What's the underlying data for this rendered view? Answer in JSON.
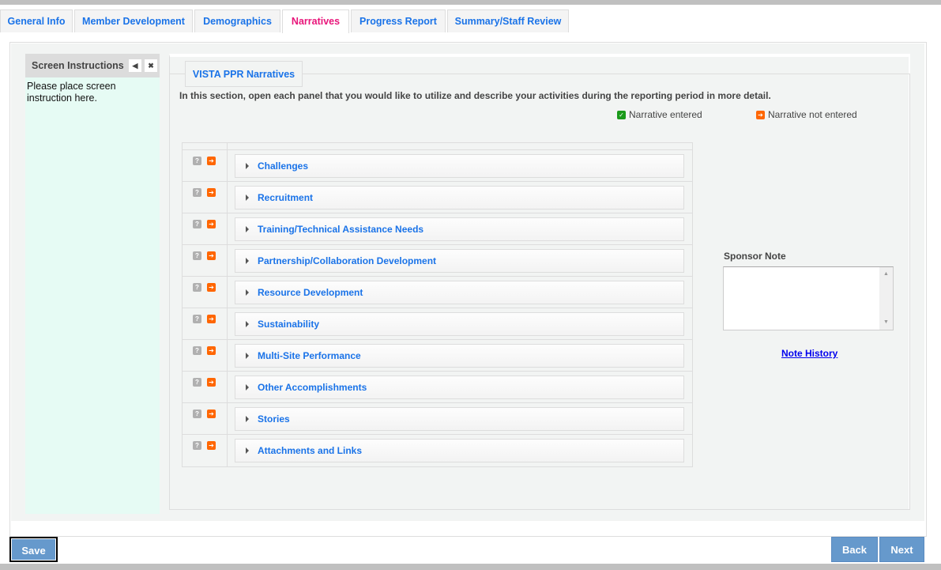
{
  "tabs": [
    {
      "label": "General Info",
      "active": false
    },
    {
      "label": "Member Development",
      "active": false
    },
    {
      "label": "Demographics",
      "active": false
    },
    {
      "label": "Narratives",
      "active": true
    },
    {
      "label": "Progress Report",
      "active": false
    },
    {
      "label": "Summary/Staff Review",
      "active": false
    }
  ],
  "instructions": {
    "title": "Screen Instructions",
    "text": "Please place screen instruction here."
  },
  "section": {
    "legend": "VISTA PPR Narratives",
    "description": "In this section, open each panel that you would like to utilize and describe your activities during the reporting period in more detail.",
    "legend_entered": "Narrative entered",
    "legend_not_entered": "Narrative not entered",
    "colors": {
      "entered": "#1a9a1a",
      "not_entered": "#ff6600",
      "link": "#1a73e8",
      "active_tab": "#e8157a"
    }
  },
  "panels": [
    {
      "label": "Challenges"
    },
    {
      "label": "Recruitment"
    },
    {
      "label": "Training/Technical Assistance Needs"
    },
    {
      "label": "Partnership/Collaboration Development"
    },
    {
      "label": "Resource Development"
    },
    {
      "label": "Sustainability"
    },
    {
      "label": "Multi-Site Performance"
    },
    {
      "label": "Other Accomplishments"
    },
    {
      "label": "Stories"
    },
    {
      "label": "Attachments and Links"
    }
  ],
  "sponsor_note": {
    "label": "Sponsor Note",
    "value": "",
    "history_link": "Note History"
  },
  "footer": {
    "save": "Save",
    "back": "Back",
    "next": "Next"
  }
}
